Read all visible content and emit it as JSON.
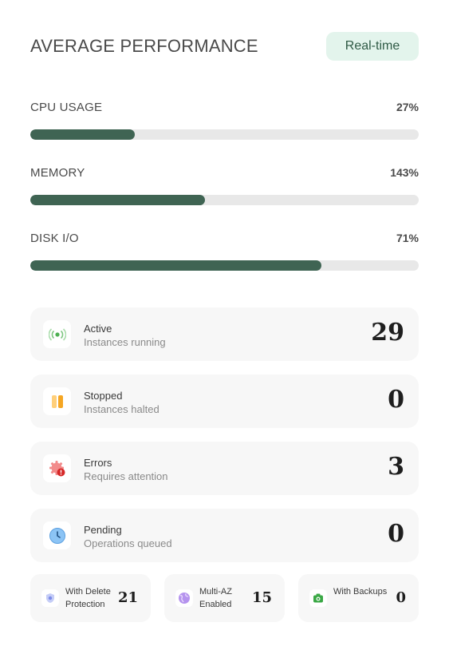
{
  "header": {
    "title": "AVERAGE PERFORMANCE",
    "badge": "Real-time"
  },
  "metrics": [
    {
      "label": "CPU USAGE",
      "value": "27%",
      "fill_fraction": 0.27
    },
    {
      "label": "MEMORY",
      "value": "143%",
      "fill_fraction": 0.45
    },
    {
      "label": "DISK I/O",
      "value": "71%",
      "fill_fraction": 0.75
    }
  ],
  "status_cards": [
    {
      "title": "Active",
      "subtitle": "Instances running",
      "value": "29",
      "icon": "signal-icon"
    },
    {
      "title": "Stopped",
      "subtitle": "Instances halted",
      "value": "0",
      "icon": "pause-icon"
    },
    {
      "title": "Errors",
      "subtitle": "Requires attention",
      "value": "3",
      "icon": "error-gear-icon"
    },
    {
      "title": "Pending",
      "subtitle": "Operations queued",
      "value": "0",
      "icon": "clock-icon"
    }
  ],
  "summary": [
    {
      "label": "With Delete Protection",
      "value": "21",
      "icon": "shield-icon"
    },
    {
      "label": "Multi-AZ Enabled",
      "value": "15",
      "icon": "globe-icon"
    },
    {
      "label": "With Backups",
      "value": "0",
      "icon": "camera-icon"
    }
  ],
  "colors": {
    "bar_fill": "#3f6453",
    "bar_track": "#e8e8e8",
    "badge_bg": "#e3f4ec",
    "card_bg": "#f7f7f7"
  }
}
